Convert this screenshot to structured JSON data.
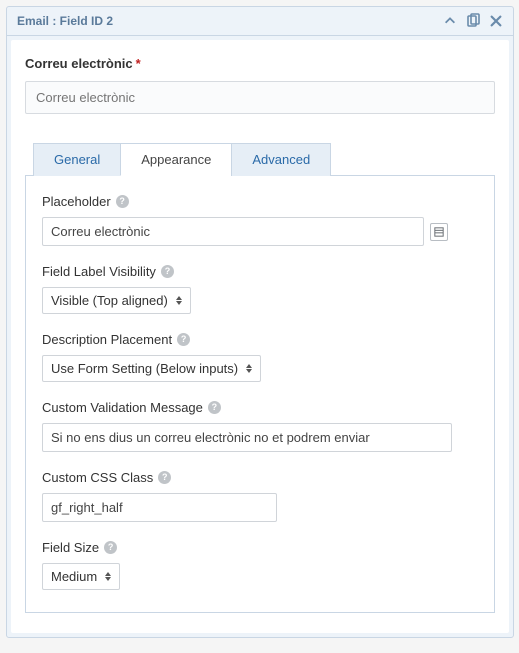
{
  "panel": {
    "title": "Email : Field ID 2"
  },
  "field": {
    "label": "Correu electrònic",
    "required_mark": "*",
    "preview_placeholder": "Correu electrònic"
  },
  "tabs": {
    "general": "General",
    "appearance": "Appearance",
    "advanced": "Advanced"
  },
  "appearance": {
    "placeholder_label": "Placeholder",
    "placeholder_value": "Correu electrònic",
    "visibility_label": "Field Label Visibility",
    "visibility_value": "Visible (Top aligned)",
    "desc_placement_label": "Description Placement",
    "desc_placement_value": "Use Form Setting (Below inputs)",
    "validation_label": "Custom Validation Message",
    "validation_value": "Si no ens dius un correu electrònic no et podrem enviar",
    "css_label": "Custom CSS Class",
    "css_value": "gf_right_half",
    "size_label": "Field Size",
    "size_value": "Medium"
  }
}
